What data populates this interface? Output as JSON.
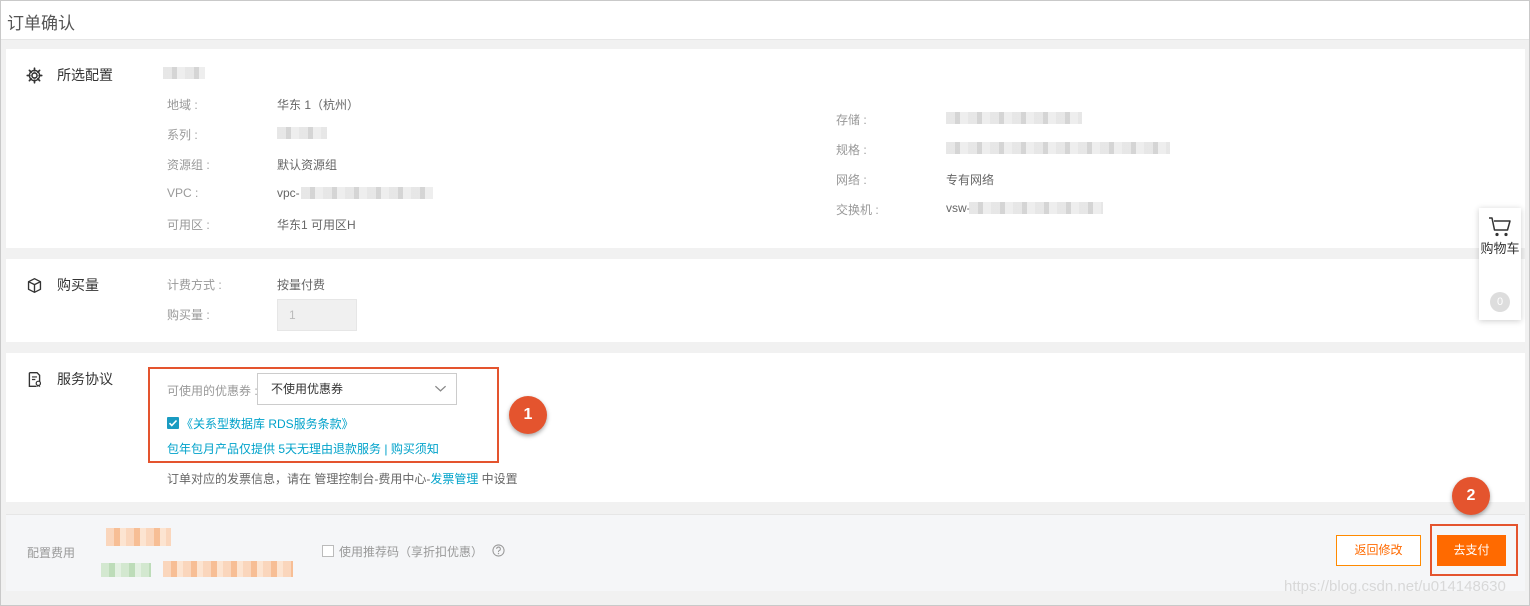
{
  "page": {
    "title": "订单确认"
  },
  "config": {
    "section_title": "所选配置",
    "left": [
      {
        "label": "地域 :",
        "value": "华东 1（杭州）"
      },
      {
        "label": "系列 :",
        "value": ""
      },
      {
        "label": "资源组 :",
        "value": "默认资源组"
      },
      {
        "label": "VPC :",
        "value": "vpc-"
      },
      {
        "label": "可用区 :",
        "value": "华东1 可用区H"
      }
    ],
    "right": [
      {
        "label": "存储 :",
        "value": ""
      },
      {
        "label": "规格 :",
        "value": ""
      },
      {
        "label": "网络 :",
        "value": "专有网络"
      },
      {
        "label": "交换机 :",
        "value": "vsw-"
      }
    ]
  },
  "purchase": {
    "section_title": "购买量",
    "billing_label": "计费方式 :",
    "billing_value": "按量付费",
    "quantity_label": "购买量 :",
    "quantity_value": "1"
  },
  "agreement": {
    "section_title": "服务协议",
    "coupon_label": "可使用的优惠券 :",
    "coupon_selected": "不使用优惠券",
    "terms_link": "《关系型数据库 RDS服务条款》",
    "terms_checked": true,
    "refund_text": "包年包月产品仅提供 5天无理由退款服务",
    "separator": "|",
    "purchase_notice": "购买须知",
    "invoice_prefix": "订单对应的发票信息，请在 管理控制台-费用中心-",
    "invoice_link": "发票管理",
    "invoice_suffix": " 中设置"
  },
  "cart": {
    "label": "购物车",
    "count": "0"
  },
  "footer": {
    "fee_label": "配置费用",
    "referral_label": "使用推荐码（享折扣优惠）",
    "back_button": "返回修改",
    "pay_button": "去支付"
  },
  "annotations": {
    "marker1": "1",
    "marker2": "2",
    "color": "#e4542e"
  },
  "watermark": "https://blog.csdn.net/u014148630"
}
